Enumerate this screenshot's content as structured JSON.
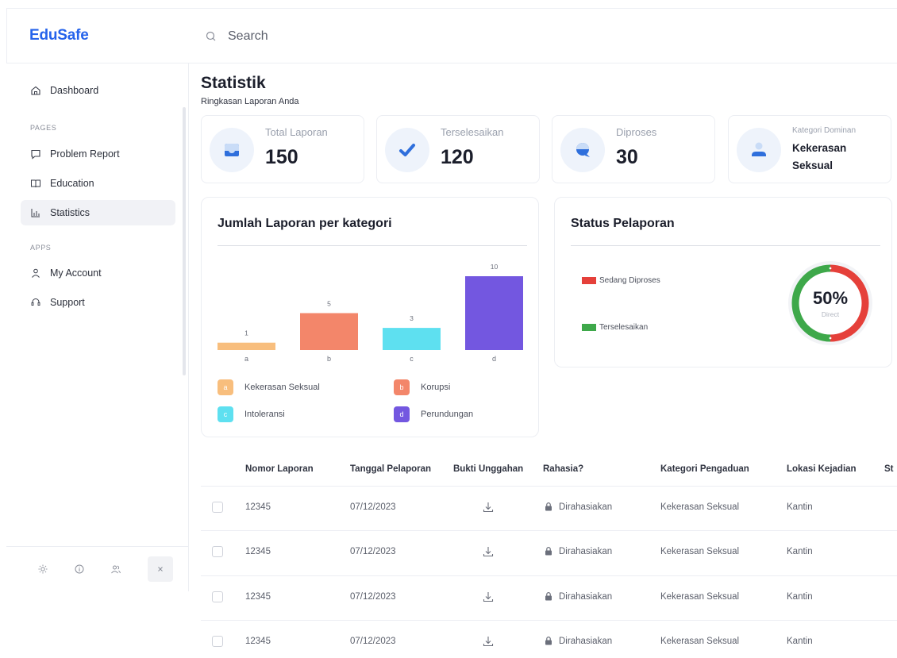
{
  "header": {
    "brand": "EduSafe",
    "search_placeholder": "Search",
    "search_icon": "search-icon"
  },
  "sidebar": {
    "dashboard": {
      "label": "Dashboard",
      "icon": "home-icon"
    },
    "pages_heading": "PAGES",
    "pages": [
      {
        "label": "Problem Report",
        "icon": "chat-icon"
      },
      {
        "label": "Education",
        "icon": "book-icon"
      },
      {
        "label": "Statistics",
        "icon": "chart-icon",
        "active": true
      }
    ],
    "apps_heading": "APPS",
    "apps": [
      {
        "label": "My Account",
        "icon": "user-icon"
      },
      {
        "label": "Support",
        "icon": "support-icon"
      }
    ],
    "footer_icons": [
      "sun-icon",
      "info-icon",
      "users-icon",
      "close-icon"
    ]
  },
  "page": {
    "title": "Statistik",
    "subtitle": "Ringkasan Laporan Anda"
  },
  "stats": [
    {
      "label": "Total Laporan",
      "value": "150",
      "icon": "inbox-icon"
    },
    {
      "label": "Terselesaikan",
      "value": "120",
      "icon": "check-icon"
    },
    {
      "label": "Diproses",
      "value": "30",
      "icon": "chat-bubble-icon"
    },
    {
      "label": "Kategori Dominan",
      "value": "Kekerasan Seksual",
      "icon": "person-icon"
    }
  ],
  "bar_panel": {
    "title": "Jumlah Laporan per kategori",
    "legend": [
      {
        "key": "a",
        "label": "Kekerasan Seksual",
        "color": "#f8be7d"
      },
      {
        "key": "b",
        "label": "Korupsi",
        "color": "#f3866a"
      },
      {
        "key": "c",
        "label": "Intoleransi",
        "color": "#5ee0f0"
      },
      {
        "key": "d",
        "label": "Perundungan",
        "color": "#7357e0"
      }
    ]
  },
  "status_panel": {
    "title": "Status Pelaporan",
    "legend": [
      {
        "label": "Sedang Diproses",
        "color": "#e5403a"
      },
      {
        "label": "Terselesaikan",
        "color": "#3ea84a"
      }
    ],
    "donut_value": "50%",
    "donut_sub": "Direct"
  },
  "chart_data": [
    {
      "type": "bar",
      "categories": [
        "a",
        "b",
        "c",
        "d"
      ],
      "values": [
        1,
        5,
        3,
        10
      ],
      "title": "Jumlah Laporan per kategori",
      "colors": [
        "#f8be7d",
        "#f3866a",
        "#5ee0f0",
        "#7357e0"
      ]
    },
    {
      "type": "pie",
      "title": "Status Pelaporan",
      "labels": [
        "Sedang Diproses",
        "Terselesaikan"
      ],
      "values": [
        50,
        50
      ],
      "colors": [
        "#e5403a",
        "#3ea84a"
      ]
    }
  ],
  "table": {
    "columns": [
      "Nomor Laporan",
      "Tanggal Pelaporan",
      "Bukti Unggahan",
      "Rahasia?",
      "Kategori Pengaduan",
      "Lokasi Kejadian",
      "St"
    ],
    "rows": [
      {
        "nomor": "12345",
        "tanggal": "07/12/2023",
        "rahasia": "Dirahasiakan",
        "kategori": "Kekerasan Seksual",
        "lokasi": "Kantin"
      },
      {
        "nomor": "12345",
        "tanggal": "07/12/2023",
        "rahasia": "Dirahasiakan",
        "kategori": "Kekerasan Seksual",
        "lokasi": "Kantin"
      },
      {
        "nomor": "12345",
        "tanggal": "07/12/2023",
        "rahasia": "Dirahasiakan",
        "kategori": "Kekerasan Seksual",
        "lokasi": "Kantin"
      },
      {
        "nomor": "12345",
        "tanggal": "07/12/2023",
        "rahasia": "Dirahasiakan",
        "kategori": "Kekerasan Seksual",
        "lokasi": "Kantin"
      }
    ]
  }
}
